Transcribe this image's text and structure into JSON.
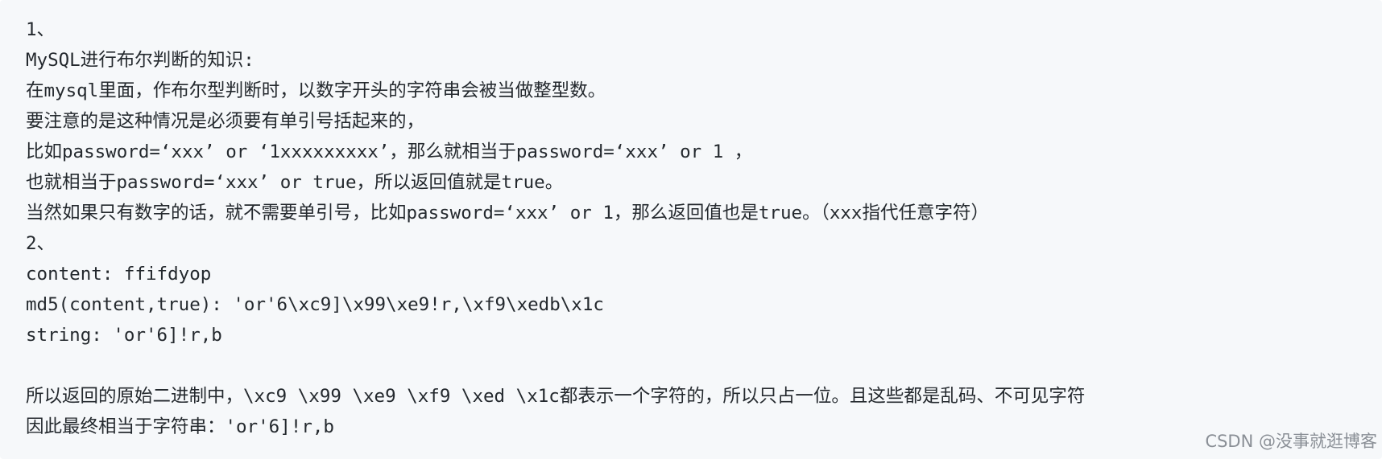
{
  "content": {
    "lines": [
      "1、",
      "MySQL进行布尔判断的知识:",
      "在mysql里面，作布尔型判断时，以数字开头的字符串会被当做整型数。",
      "要注意的是这种情况是必须要有单引号括起来的，",
      "比如password=‘xxx’ or ‘1xxxxxxxxx’，那么就相当于password=‘xxx’ or 1 ，",
      "也就相当于password=‘xxx’ or true，所以返回值就是true。",
      "当然如果只有数字的话，就不需要单引号，比如password=‘xxx’ or 1，那么返回值也是true。（xxx指代任意字符）",
      "2、",
      "content: ffifdyop",
      "md5(content,true): 'or'6\\xc9]\\x99\\xe9!r,\\xf9\\xedb\\x1c",
      "string: 'or'6]!r,b",
      "",
      "所以返回的原始二进制中，\\xc9 \\x99 \\xe9 \\xf9 \\xed \\x1c都表示一个字符的，所以只占一位。且这些都是乱码、不可见字符",
      "因此最终相当于字符串：'or'6]!r,b"
    ]
  },
  "watermark": "CSDN @没事就逛博客"
}
